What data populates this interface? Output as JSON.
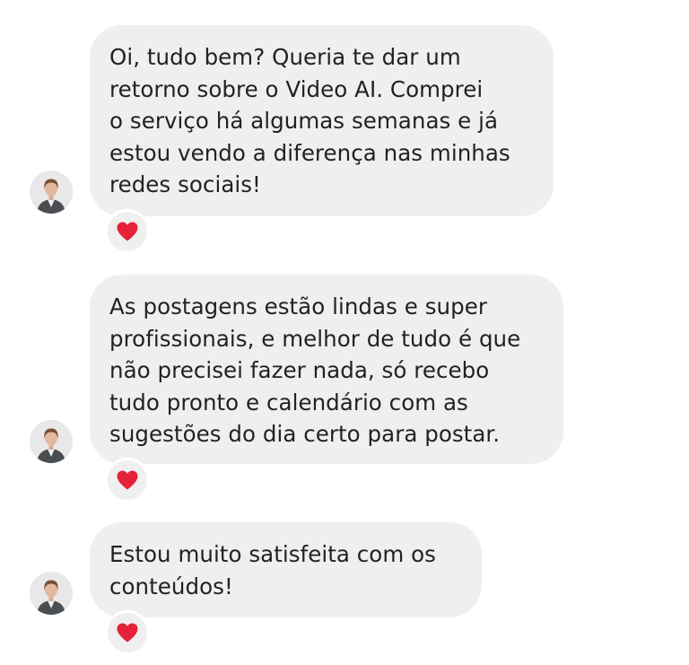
{
  "messages": [
    {
      "lines": [
        "Oi, tudo bem? Queria te dar um",
        "retorno sobre o Video AI. Comprei",
        "o serviço há algumas semanas e já",
        "estou vendo a diferença nas minhas",
        "redes sociais!"
      ],
      "reaction": "heart-icon"
    },
    {
      "lines": [
        "As postagens estão lindas e super",
        "profissionais, e melhor de tudo é que",
        "não precisei fazer nada, só recebo",
        "tudo pronto e calendário com as",
        "sugestões do dia certo para postar."
      ],
      "reaction": "heart-icon"
    },
    {
      "lines": [
        "Estou muito satisfeita com os",
        "conteúdos!"
      ],
      "reaction": "heart-icon"
    }
  ],
  "colors": {
    "bubble": "#efefef",
    "text": "#222222",
    "heart": "#e5213c",
    "background": "#ffffff"
  }
}
